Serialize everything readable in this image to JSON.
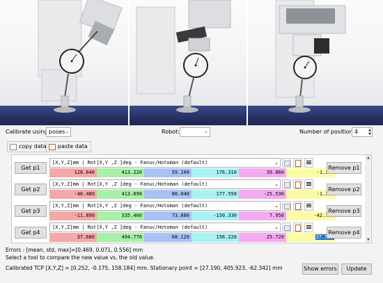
{
  "photos": [
    {
      "alt": "robot camera view 1"
    },
    {
      "alt": "robot camera view 2"
    },
    {
      "alt": "robot camera view 3"
    }
  ],
  "controls": {
    "calibrate_using_label": "Calibrate using:",
    "calibrate_using_value": "poses",
    "robot_label": "Robot:",
    "robot_value": "",
    "num_positions_label": "Number of positions:",
    "num_positions_value": "4",
    "copy_data": "copy data",
    "paste_data": "paste data"
  },
  "rows": [
    {
      "get": "Get p1",
      "format": "[X,Y,Z]mm | Rot[X,Y ,Z ]deg - Fanuc/Hotoman (default)",
      "values": [
        "128.640",
        "413.220",
        "59.100",
        "176.310",
        "39.860",
        "-1.380"
      ],
      "remove": "Remove p1"
    },
    {
      "get": "Get p2",
      "format": "[X,Y,Z]mm | Rot[X,Y ,Z ]deg - Fanuc/Hotoman (default)",
      "values": [
        "-40.480",
        "413.890",
        "80.040",
        "177.550",
        "-25.530",
        "-1.330"
      ],
      "remove": "Remove p2"
    },
    {
      "get": "Get p3",
      "format": "[X,Y,Z]mm | Rot[X,Y ,Z ]deg - Fanuc/Hotoman (default)",
      "values": [
        "-11.890",
        "335.400",
        "73.880",
        "-150.330",
        "7.950",
        "-42.130"
      ],
      "remove": "Remove p3"
    },
    {
      "get": "Get p4",
      "format": "[X,Y,Z]mm | Rot[X,Y ,Z ]deg - Fanuc/Hotoman (default)",
      "values": [
        "37.680",
        "494.770",
        "68.120",
        "156.220",
        "25.720",
        "37.540"
      ],
      "remove": "Remove p4"
    }
  ],
  "status": {
    "errors": "Errors : [mean, std, max]=[0.469, 0.071, 0.556] mm",
    "hint": "Select a tool to compare the new value vs. the old value.",
    "calibrated": "Calibrated TCP [X,Y,Z] = [0.252, -0.175, 158.184] mm. Stationary point = [27.190, 405.923, -62.342] mm"
  },
  "buttons": {
    "show_errors": "Show errors",
    "update": "Update"
  },
  "colors": {
    "accent_selection": "#2a6fd0",
    "x_cell": "#f5a8a8",
    "y_cell": "#a8f0a8",
    "z_cell": "#a8c2f6",
    "rx_cell": "#a8f2f4",
    "ry_cell": "#f4aaf0",
    "rz_cell": "#fbfba6"
  }
}
